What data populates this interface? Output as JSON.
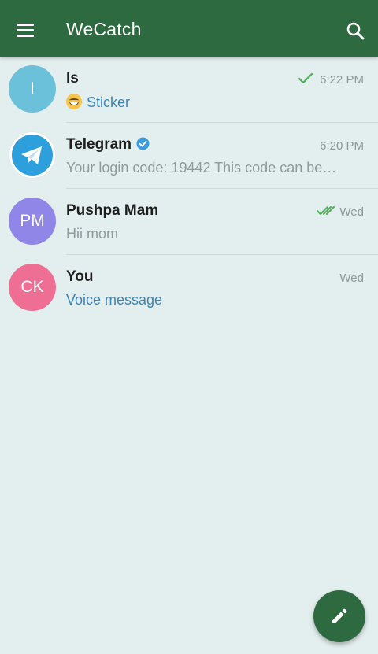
{
  "app": {
    "title": "WeCatch",
    "accent_color": "#2d6a3f"
  },
  "toolbar": {
    "menu_icon": "hamburger-menu-icon",
    "search_icon": "search-icon"
  },
  "chats": [
    {
      "initials": "I",
      "avatar_color": "#6bc1d9",
      "name": "Is",
      "time": "6:22 PM",
      "status": "sent",
      "preview": "Sticker",
      "preview_prefix_icon": "grinning-emoji",
      "preview_style": "accent"
    },
    {
      "initials": "",
      "avatar_icon": "telegram-logo",
      "name": "Telegram",
      "verified": true,
      "time": "6:20 PM",
      "preview": "Your login code: 19442  This code can be…",
      "preview_style": "muted"
    },
    {
      "initials": "PM",
      "avatar_color": "#8f86e8",
      "name": "Pushpa Mam",
      "time": "Wed",
      "status": "read",
      "preview": "Hii mom",
      "preview_style": "muted"
    },
    {
      "initials": "CK",
      "avatar_color": "#ef6e93",
      "name": "You",
      "time": "Wed",
      "preview": "Voice message",
      "preview_style": "accent"
    }
  ],
  "fab": {
    "icon": "pencil-icon"
  }
}
